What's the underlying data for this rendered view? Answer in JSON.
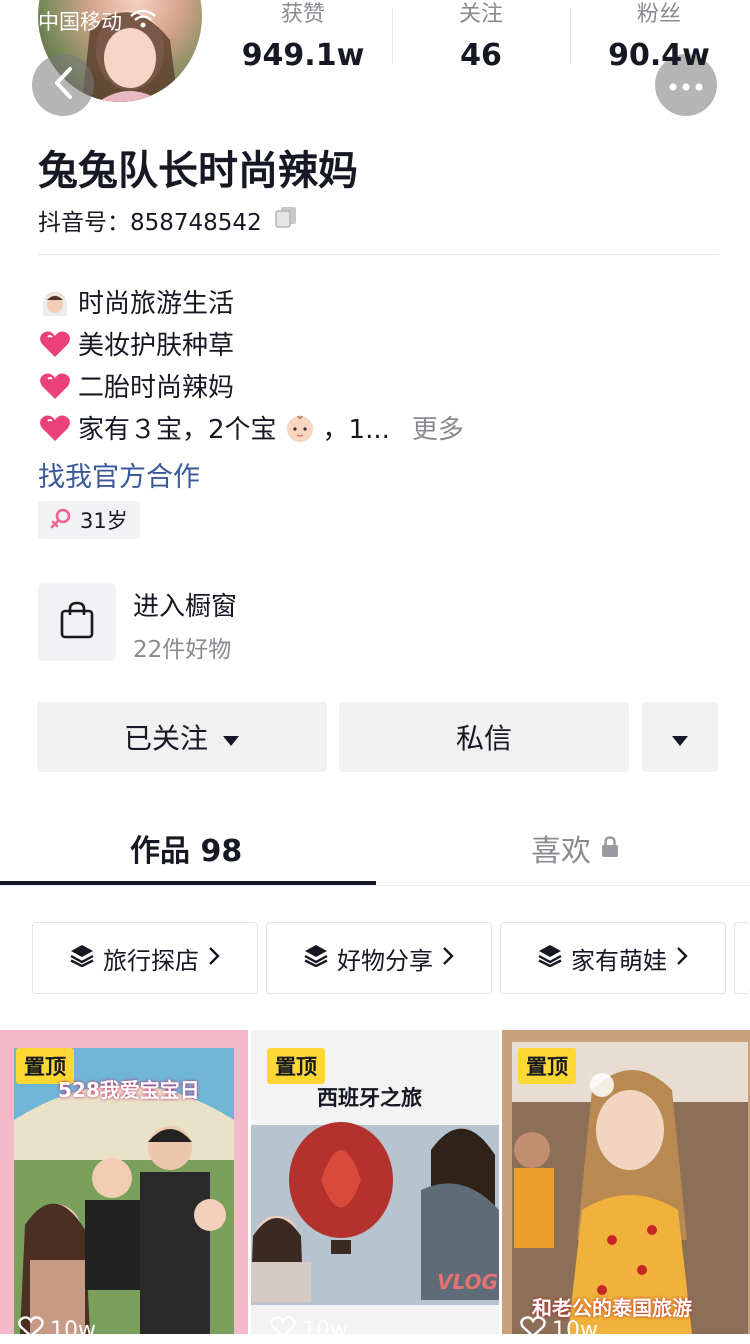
{
  "status_bar": {
    "carrier": "中国移动"
  },
  "stats": [
    {
      "label": "获赞",
      "value": "949.1w"
    },
    {
      "label": "关注",
      "value": "46"
    },
    {
      "label": "粉丝",
      "value": "90.4w"
    }
  ],
  "profile": {
    "nickname": "兔兔队长时尚辣妈",
    "uid_label": "抖音号：",
    "uid": "858748542"
  },
  "bio": {
    "lines": [
      {
        "icon": "bride-icon",
        "text": "时尚旅游生活"
      },
      {
        "icon": "heart-icon",
        "text": "美妆护肤种草"
      },
      {
        "icon": "heart-icon",
        "text": "二胎时尚辣妈"
      },
      {
        "icon": "heart-icon",
        "text_a": "家有３宝，2个宝",
        "text_b": "，1...",
        "more": "更多"
      }
    ],
    "official_link": "找我官方合作",
    "age": "31岁"
  },
  "shop": {
    "title": "进入橱窗",
    "subtitle": "22件好物"
  },
  "actions": {
    "follow": "已关注",
    "message": "私信"
  },
  "tabs": {
    "works": "作品 98",
    "likes": "喜欢"
  },
  "collections": [
    "旅行探店",
    "好物分享",
    "家有萌娃"
  ],
  "videos": [
    {
      "badge": "置顶",
      "caption": "528我爱宝宝日",
      "likes": "10w"
    },
    {
      "badge": "置顶",
      "caption": "西班牙之旅",
      "sub_caption": "VLOG",
      "likes": "10w"
    },
    {
      "badge": "置顶",
      "caption": "和老公的泰国旅游",
      "likes": "10w"
    }
  ],
  "colors": {
    "accent_link": "#3b5998",
    "pin_badge": "#fdd835",
    "text": "#161823",
    "muted": "#8a8b91"
  }
}
